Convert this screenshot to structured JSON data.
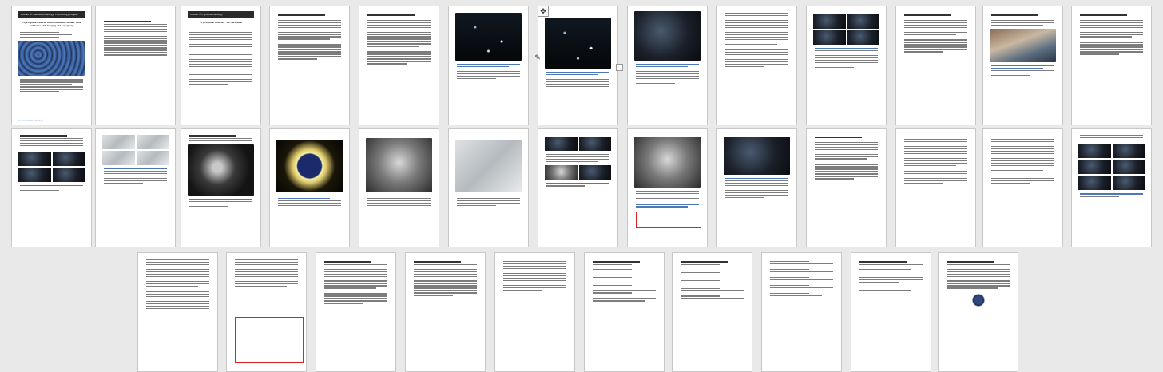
{
  "journal_banner": "Journal of Nanobiotechnology: Cryobiology Chapter",
  "article_title": "Cryo-Optical Contrast in Ice-Nucleation Studies: Dual Validation with Imaging and Cryoplasty",
  "footer_left": "Journal of Cryobiotechnology",
  "footer_right": "Page 1",
  "toolbar": {
    "move_icon": "move-arrows-icon",
    "pen_icon": "pen-icon"
  },
  "colors": {
    "accent_link": "#4d78b8",
    "highlight_box": "#d22222",
    "banner": "#2a2a2a"
  }
}
